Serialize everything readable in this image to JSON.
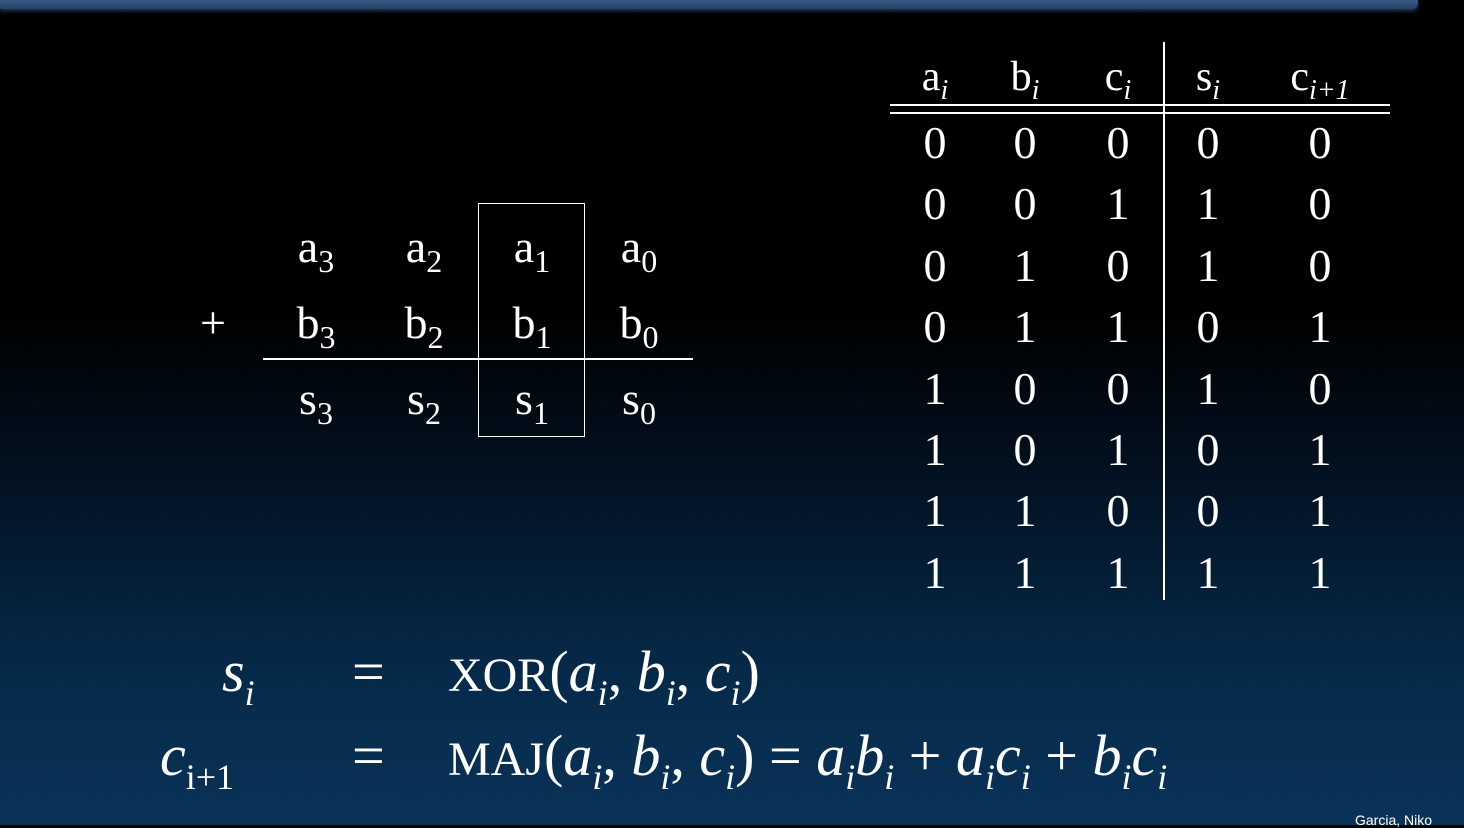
{
  "addition": {
    "plus": "+",
    "rows": [
      [
        {
          "b": "a",
          "s": "3"
        },
        {
          "b": "a",
          "s": "2"
        },
        {
          "b": "a",
          "s": "1"
        },
        {
          "b": "a",
          "s": "0"
        }
      ],
      [
        {
          "b": "b",
          "s": "3"
        },
        {
          "b": "b",
          "s": "2"
        },
        {
          "b": "b",
          "s": "1"
        },
        {
          "b": "b",
          "s": "0"
        }
      ],
      [
        {
          "b": "s",
          "s": "3"
        },
        {
          "b": "s",
          "s": "2"
        },
        {
          "b": "s",
          "s": "1"
        },
        {
          "b": "s",
          "s": "0"
        }
      ]
    ]
  },
  "truth_table": {
    "headers": [
      {
        "b": "a",
        "s": "i"
      },
      {
        "b": "b",
        "s": "i"
      },
      {
        "b": "c",
        "s": "i"
      },
      {
        "b": "s",
        "s": "i"
      },
      {
        "b": "c",
        "s": "i+1"
      }
    ],
    "rows": [
      [
        "0",
        "0",
        "0",
        "0",
        "0"
      ],
      [
        "0",
        "0",
        "1",
        "1",
        "0"
      ],
      [
        "0",
        "1",
        "0",
        "1",
        "0"
      ],
      [
        "0",
        "1",
        "1",
        "0",
        "1"
      ],
      [
        "1",
        "0",
        "0",
        "1",
        "0"
      ],
      [
        "1",
        "0",
        "1",
        "0",
        "1"
      ],
      [
        "1",
        "1",
        "0",
        "0",
        "1"
      ],
      [
        "1",
        "1",
        "1",
        "1",
        "1"
      ]
    ]
  },
  "equations": {
    "eq1": {
      "lhs_base": "s",
      "lhs_sub": "i",
      "equals": "=",
      "func": "XOR",
      "open": "(",
      "args": [
        {
          "b": "a",
          "s": "i"
        },
        {
          "b": "b",
          "s": "i"
        },
        {
          "b": "c",
          "s": "i"
        }
      ],
      "sep": ", ",
      "close": ")"
    },
    "eq2": {
      "lhs_base": "c",
      "lhs_sub": "i+1",
      "equals": "=",
      "func": "MAJ",
      "open": "(",
      "args": [
        {
          "b": "a",
          "s": "i"
        },
        {
          "b": "b",
          "s": "i"
        },
        {
          "b": "c",
          "s": "i"
        }
      ],
      "sep": ", ",
      "close": ")",
      "rhs_equals": " = ",
      "plus": " + ",
      "terms": [
        [
          {
            "b": "a",
            "s": "i"
          },
          {
            "b": "b",
            "s": "i"
          }
        ],
        [
          {
            "b": "a",
            "s": "i"
          },
          {
            "b": "c",
            "s": "i"
          }
        ],
        [
          {
            "b": "b",
            "s": "i"
          },
          {
            "b": "c",
            "s": "i"
          }
        ]
      ]
    }
  },
  "credit": "Garcia, Niko"
}
